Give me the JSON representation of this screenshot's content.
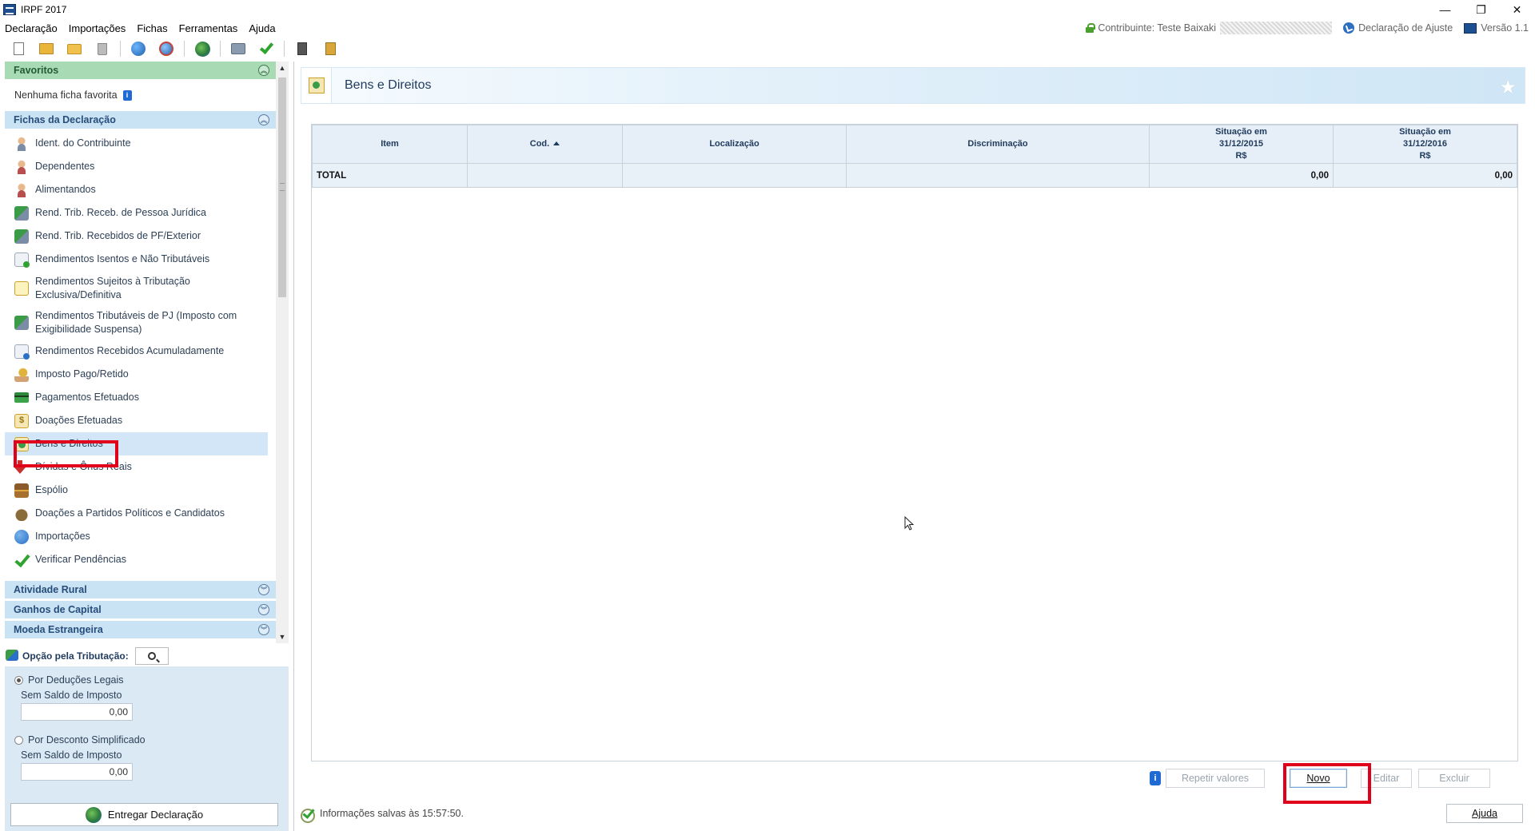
{
  "window": {
    "title": "IRPF 2017",
    "controls": [
      "—",
      "❐",
      "✕"
    ]
  },
  "menu": [
    "Declaração",
    "Importações",
    "Fichas",
    "Ferramentas",
    "Ajuda"
  ],
  "header_info": {
    "contribuinte": "Contribuinte: Teste Baixaki",
    "declaracao": "Declaração de Ajuste",
    "versao": "Versão 1.1"
  },
  "toolbar": {
    "icons": [
      "new-document-icon",
      "open-document-icon",
      "folder-icon",
      "trash-icon",
      "globe-transmit-icon",
      "globe-receive-icon",
      "earth-icon",
      "print-icon",
      "check-icon",
      "calculator-icon",
      "clipboard-icon"
    ]
  },
  "sidebar": {
    "favoritos": {
      "title": "Favoritos",
      "empty_text": "Nenhuma ficha favorita"
    },
    "fichas": {
      "title": "Fichas da Declaração",
      "selected": "Bens e Direitos",
      "items": [
        {
          "label": "Ident. do Contribuinte",
          "icon": "person-icon"
        },
        {
          "label": "Dependentes",
          "icon": "dependents-icon"
        },
        {
          "label": "Alimentandos",
          "icon": "people-icon"
        },
        {
          "label": "Rend. Trib. Receb. de Pessoa Jurídica",
          "icon": "income-pj-icon"
        },
        {
          "label": "Rend. Trib. Recebidos de PF/Exterior",
          "icon": "income-pf-icon"
        },
        {
          "label": "Rendimentos Isentos e Não Tributáveis",
          "icon": "exempt-income-icon"
        },
        {
          "label": "Rendimentos Sujeitos à Tributação Exclusiva/Definitiva",
          "icon": "warning-doc-icon"
        },
        {
          "label": "Rendimentos Tributáveis de PJ (Imposto com Exigibilidade Suspensa)",
          "icon": "suspended-tax-icon"
        },
        {
          "label": "Rendimentos Recebidos Acumuladamente",
          "icon": "accumulated-income-icon"
        },
        {
          "label": "Imposto Pago/Retido",
          "icon": "tax-paid-icon"
        },
        {
          "label": "Pagamentos Efetuados",
          "icon": "credit-card-icon"
        },
        {
          "label": "Doações Efetuadas",
          "icon": "donation-icon"
        },
        {
          "label": "Bens e Direitos",
          "icon": "assets-icon"
        },
        {
          "label": "Dívidas e Ônus Reais",
          "icon": "debt-arrow-icon"
        },
        {
          "label": "Espólio",
          "icon": "estate-chest-icon"
        },
        {
          "label": "Doações a Partidos Políticos e Candidatos",
          "icon": "money-bag-icon"
        },
        {
          "label": "Importações",
          "icon": "import-globe-icon"
        },
        {
          "label": "Verificar Pendências",
          "icon": "check-icon"
        }
      ]
    },
    "collapsed_sections": [
      "Atividade Rural",
      "Ganhos de Capital",
      "Moeda Estrangeira"
    ]
  },
  "options": {
    "title": "Opção pela Tributação:",
    "por_deducoes": {
      "label": "Por Deduções Legais",
      "sub_label": "Sem Saldo de Imposto",
      "value": "0,00",
      "selected": true
    },
    "por_desconto": {
      "label": "Por Desconto Simplificado",
      "sub_label": "Sem Saldo de Imposto",
      "value": "0,00",
      "selected": false
    },
    "entregar": "Entregar Declaração"
  },
  "main": {
    "title": "Bens e Direitos",
    "table": {
      "headers": {
        "item": "Item",
        "cod": "Cod.",
        "localizacao": "Localização",
        "discriminacao": "Discriminação",
        "sit2015": [
          "Situação em",
          "31/12/2015",
          "R$"
        ],
        "sit2016": [
          "Situação em",
          "31/12/2016",
          "R$"
        ]
      },
      "total_row": {
        "label": "TOTAL",
        "sit2015": "0,00",
        "sit2016": "0,00"
      }
    },
    "buttons": {
      "repetir": "Repetir valores",
      "novo": "Novo",
      "editar": "Editar",
      "excluir": "Excluir",
      "ajuda": "Ajuda"
    },
    "status": "Informações salvas às 15:57:50."
  },
  "colors": {
    "highlight": "#e0001b",
    "header_blue": "#c9e2f4",
    "favoritos_green": "#a8dbb4",
    "selected_row": "#d2e6f7"
  }
}
